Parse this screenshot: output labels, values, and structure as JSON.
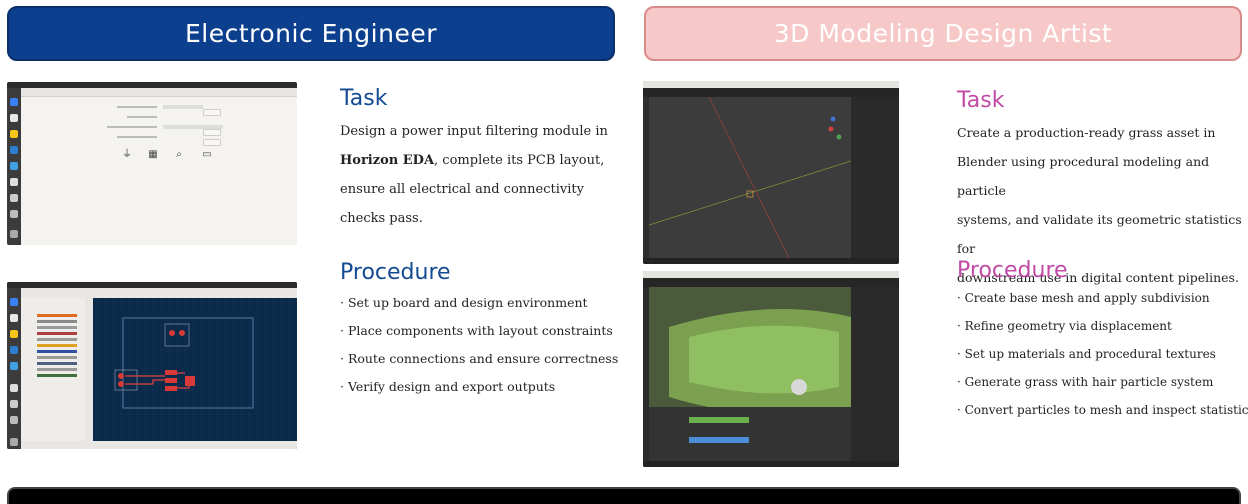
{
  "left_section": {
    "banner": "Electronic Engineer",
    "task_heading": "Task",
    "task_lines": [
      "Design a power input filtering module in",
      "Horizon EDA",
      ", complete its PCB layout,",
      "ensure all electrical and connectivity",
      "checks pass."
    ],
    "procedure_heading": "Procedure",
    "procedure_steps": [
      "· Set up board and design environment",
      "· Place components with layout constraints",
      "· Route connections and ensure correctness",
      "· Verify design and export outputs"
    ]
  },
  "right_section": {
    "banner": "3D Modeling Design Artist",
    "task_heading": "Task",
    "task_lines": [
      "Create a production-ready grass asset in",
      "Blender using procedural modeling and particle",
      "systems, and validate its geometric statistics for",
      "downstream use in digital content pipelines."
    ],
    "procedure_heading": "Procedure",
    "procedure_steps": [
      "· Create base mesh and apply subdivision",
      "· Refine geometry via displacement",
      "· Set up materials and procedural textures",
      "· Generate grass with hair particle system",
      "· Convert particles to mesh and inspect statistics"
    ]
  },
  "colors": {
    "left_banner": "#0c3f8e",
    "right_banner": "#f6c8c7",
    "left_heading": "#144a92",
    "right_heading": "#c04aa6"
  },
  "icons": [
    "schematic-icon",
    "board-icon",
    "part-browser-icon",
    "project-folder-icon"
  ]
}
